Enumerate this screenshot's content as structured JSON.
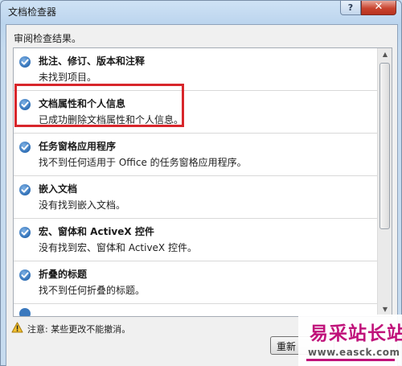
{
  "window": {
    "title": "文档检查器",
    "help_glyph": "?",
    "close_glyph": "✕"
  },
  "header": {
    "label": "审阅检查结果。"
  },
  "results": [
    {
      "title": "批注、修订、版本和注释",
      "desc": "未找到项目。",
      "icon": "check-circle-icon"
    },
    {
      "title": "文档属性和个人信息",
      "desc": "已成功删除文档属性和个人信息。",
      "icon": "check-circle-icon"
    },
    {
      "title": "任务窗格应用程序",
      "desc": "找不到任何适用于 Office 的任务窗格应用程序。",
      "icon": "check-circle-icon"
    },
    {
      "title": "嵌入文档",
      "desc": "没有找到嵌入文档。",
      "icon": "check-circle-icon"
    },
    {
      "title": "宏、窗体和 ActiveX 控件",
      "desc": "没有找到宏、窗体和 ActiveX 控件。",
      "icon": "check-circle-icon"
    },
    {
      "title": "折叠的标题",
      "desc": "找不到任何折叠的标题。",
      "icon": "check-circle-icon"
    }
  ],
  "footer": {
    "warning": "注意: 某些更改不能撤消。",
    "reinspect_label": "重新"
  },
  "watermark": {
    "text": "易采站长站",
    "url": "www.easck.com"
  },
  "colors": {
    "highlight": "#d8262b",
    "check": "#2f6fb6",
    "watermark": "#c0127a"
  }
}
